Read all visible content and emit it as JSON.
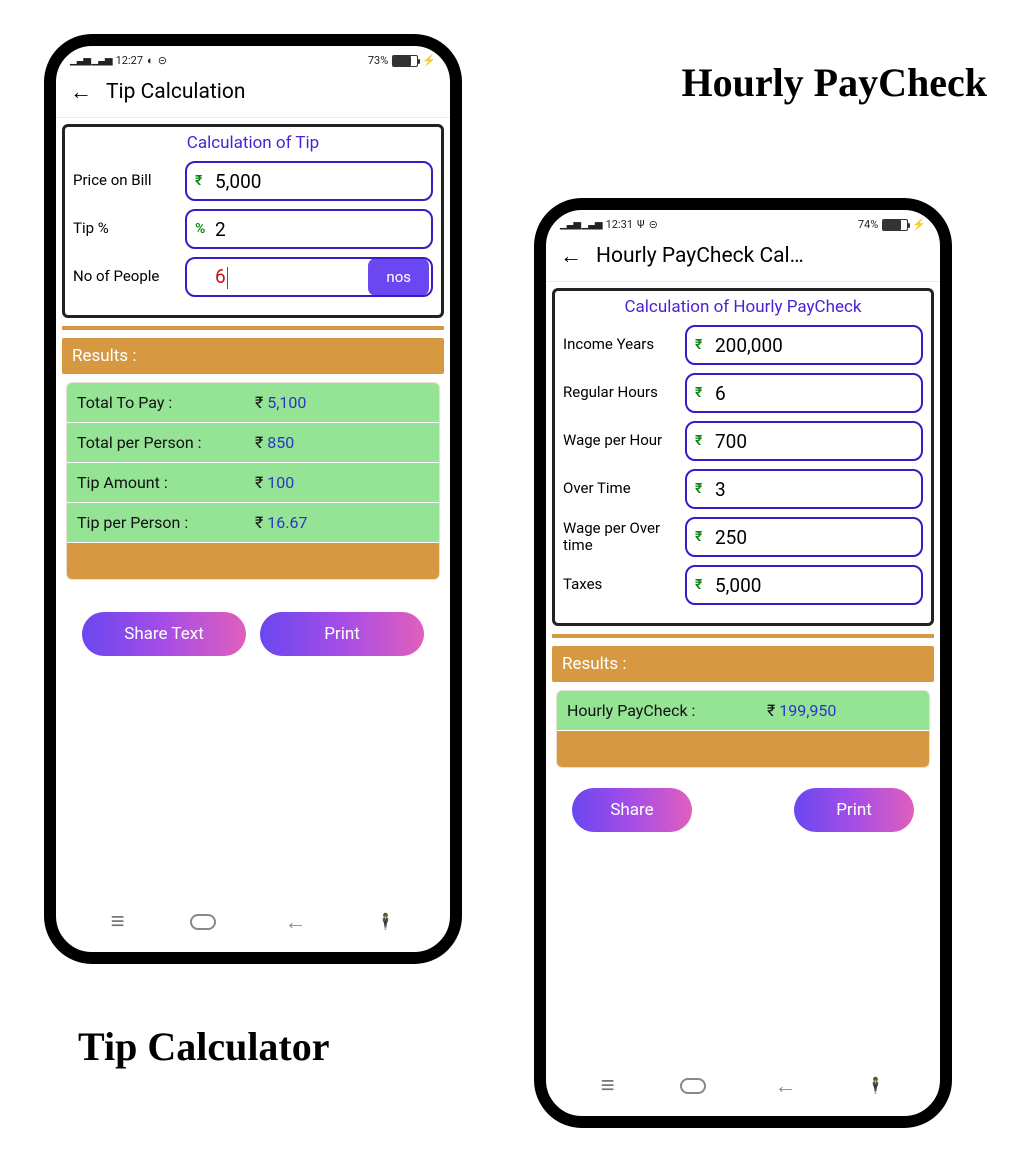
{
  "phoneLeft": {
    "status": {
      "time": "12:27",
      "signals": "4G 3G",
      "battery": "73%",
      "batteryFillPct": 73
    },
    "appbar": {
      "title": "Tip Calculation"
    },
    "calc": {
      "title": "Calculation of Tip",
      "fields": {
        "price": {
          "label": "Price on Bill",
          "unit": "₹",
          "value": "5,000"
        },
        "tip": {
          "label": "Tip %",
          "unit": "%",
          "value": "2"
        },
        "people": {
          "label": "No of People",
          "unit": "",
          "value": "6",
          "suffixBtn": "nos"
        }
      }
    },
    "results": {
      "header": "Results :",
      "rows": [
        {
          "label": "Total To Pay :",
          "cur": "₹",
          "val": "5,100"
        },
        {
          "label": "Total per Person :",
          "cur": "₹",
          "val": "850"
        },
        {
          "label": "Tip Amount :",
          "cur": "₹",
          "val": "100"
        },
        {
          "label": "Tip per Person :",
          "cur": "₹",
          "val": "16.67"
        }
      ]
    },
    "buttons": {
      "share": "Share Text",
      "print": "Print"
    }
  },
  "phoneRight": {
    "status": {
      "time": "12:31",
      "signals": "4G 3G",
      "battery": "74%",
      "batteryFillPct": 74
    },
    "appbar": {
      "title": "Hourly PayCheck Cal…"
    },
    "calc": {
      "title": "Calculation of Hourly PayCheck",
      "fields": {
        "income": {
          "label": "Income Years",
          "unit": "₹",
          "value": "200,000"
        },
        "hours": {
          "label": "Regular Hours",
          "unit": "₹",
          "value": "6"
        },
        "wage": {
          "label": "Wage per Hour",
          "unit": "₹",
          "value": "700"
        },
        "ot": {
          "label": "Over Time",
          "unit": "₹",
          "value": "3"
        },
        "otwage": {
          "label": "Wage per Over time",
          "unit": "₹",
          "value": "250"
        },
        "taxes": {
          "label": "Taxes",
          "unit": "₹",
          "value": "5,000"
        }
      }
    },
    "results": {
      "header": "Results :",
      "rows": [
        {
          "label": "Hourly PayCheck :",
          "cur": "₹",
          "val": "199,950"
        }
      ]
    },
    "buttons": {
      "share": "Share",
      "print": "Print"
    }
  },
  "headlines": {
    "right": "Hourly PayCheck",
    "left": "Tip Calculator"
  }
}
